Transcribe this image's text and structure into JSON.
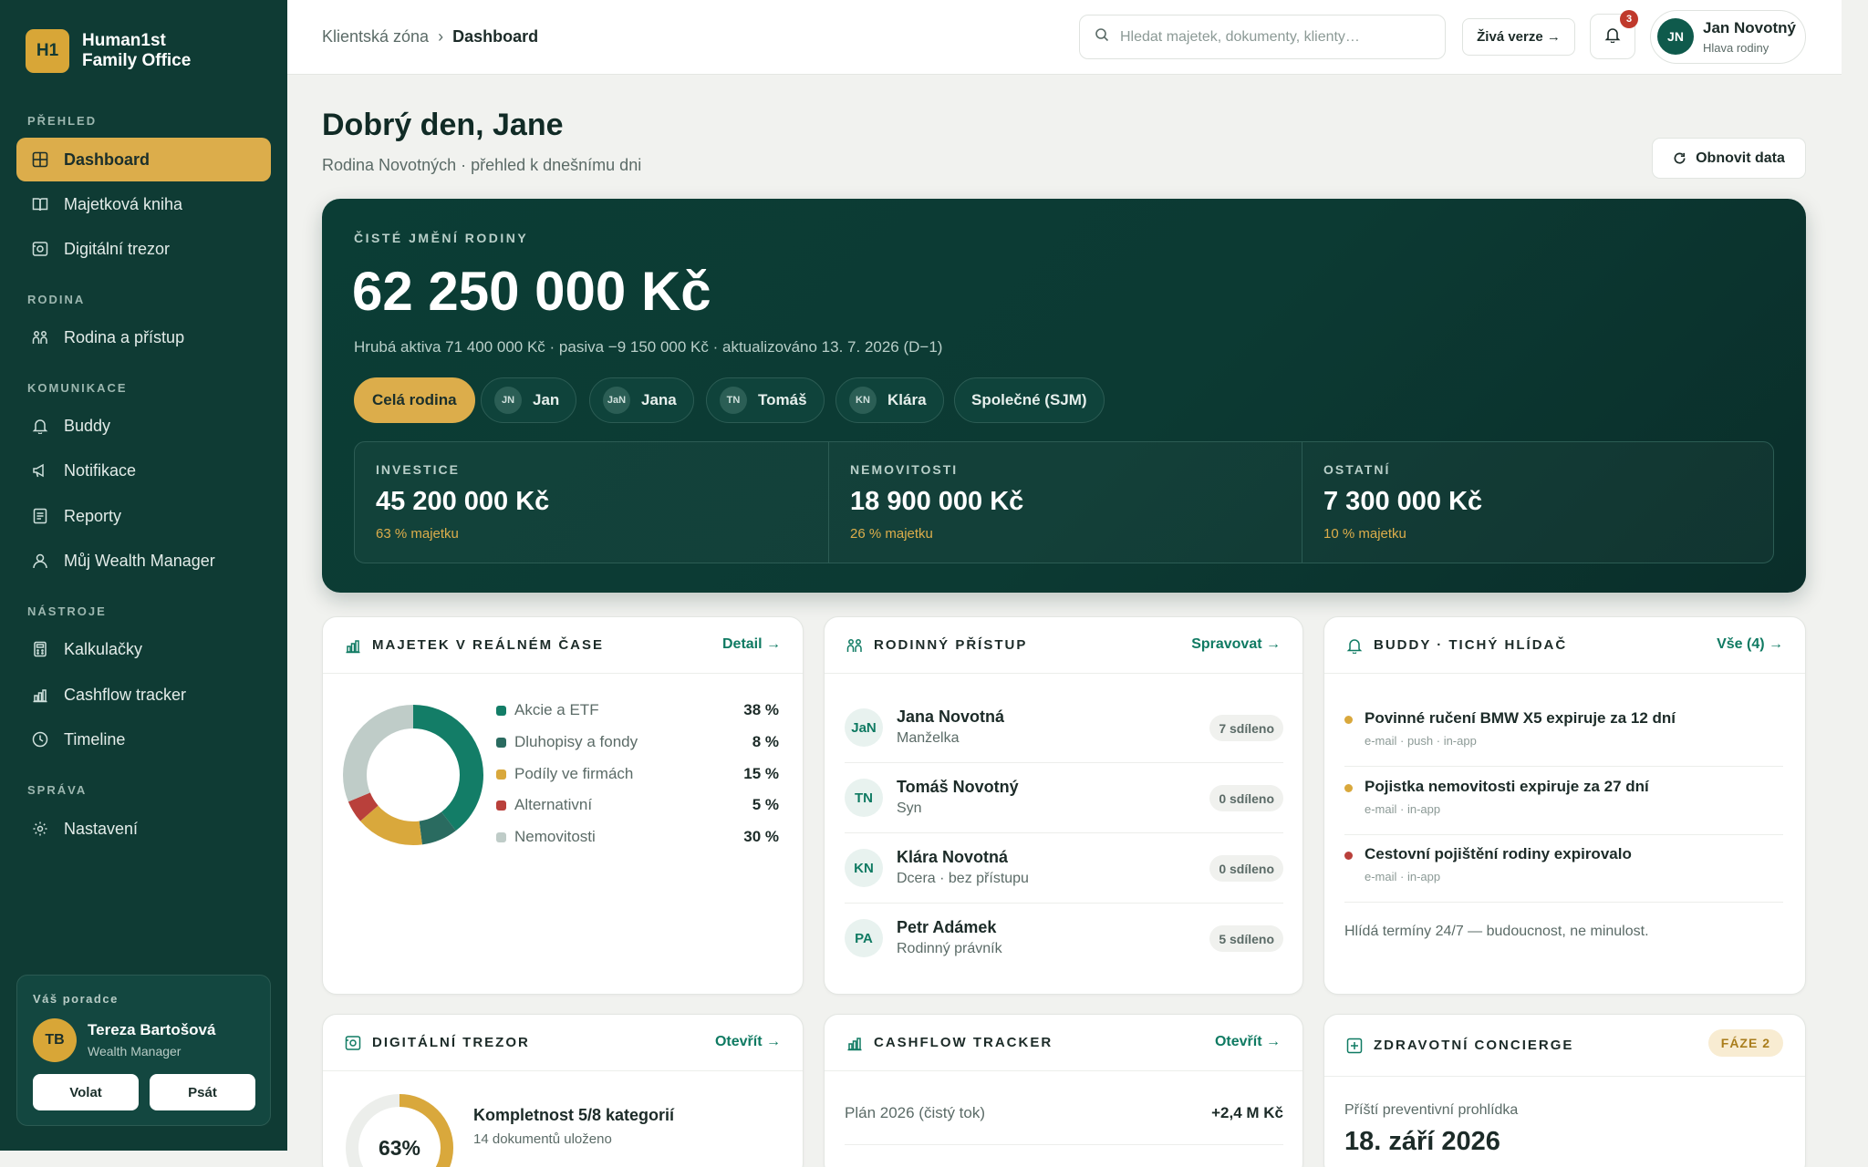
{
  "brand": {
    "logo": "H1",
    "name_line1": "Human1st",
    "name_line2": "Family Office"
  },
  "sidebar": {
    "sections": [
      {
        "label": "PŘEHLED"
      },
      {
        "label": "RODINA"
      },
      {
        "label": "KOMUNIKACE"
      },
      {
        "label": "NÁSTROJE"
      },
      {
        "label": "SPRÁVA"
      }
    ],
    "items": [
      {
        "label": "Dashboard",
        "icon": "grid-icon",
        "active": true
      },
      {
        "label": "Majetková kniha",
        "icon": "book-icon"
      },
      {
        "label": "Digitální trezor",
        "icon": "vault-icon"
      },
      {
        "label": "Rodina a přístup",
        "icon": "family-icon"
      },
      {
        "label": "Buddy",
        "icon": "bell-icon"
      },
      {
        "label": "Notifikace",
        "icon": "megaphone-icon"
      },
      {
        "label": "Reporty",
        "icon": "report-icon"
      },
      {
        "label": "Můj Wealth Manager",
        "icon": "user-icon"
      },
      {
        "label": "Kalkulačky",
        "icon": "calculator-icon"
      },
      {
        "label": "Cashflow tracker",
        "icon": "chart-icon"
      },
      {
        "label": "Timeline",
        "icon": "clock-icon"
      },
      {
        "label": "Nastavení",
        "icon": "gear-icon"
      }
    ],
    "advisor": {
      "title": "Váš poradce",
      "initials": "TB",
      "name": "Tereza Bartošová",
      "role": "Wealth Manager",
      "call_label": "Volat",
      "write_label": "Psát"
    }
  },
  "topbar": {
    "breadcrumb_root": "Klientská zóna",
    "breadcrumb_sep": "›",
    "breadcrumb_current": "Dashboard",
    "search_placeholder": "Hledat majetek, dokumenty, klienty…",
    "live_label": "Živá verze →",
    "notifications_count": "3",
    "user": {
      "initials": "JN",
      "name": "Jan Novotný",
      "role": "Hlava rodiny"
    }
  },
  "page": {
    "greeting": "Dobrý den, Jane",
    "subtitle": "Rodina Novotných · přehled k dnešnímu dni",
    "refresh_label": "Obnovit data"
  },
  "networth": {
    "label": "ČISTÉ JMĚNÍ RODINY",
    "value": "62 250 000 Kč",
    "sub": "Hrubá aktiva 71 400 000 Kč · pasiva −9 150 000 Kč · aktualizováno 13. 7. 2026 (D−1)",
    "filters": [
      {
        "label": "Celá rodina",
        "initials": "",
        "active": true
      },
      {
        "label": "Jan",
        "initials": "JN"
      },
      {
        "label": "Jana",
        "initials": "JaN"
      },
      {
        "label": "Tomáš",
        "initials": "TN"
      },
      {
        "label": "Klára",
        "initials": "KN"
      },
      {
        "label": "Společné (SJM)",
        "initials": ""
      }
    ],
    "stats": [
      {
        "label": "INVESTICE",
        "value": "45 200 000 Kč",
        "pct": "63 % majetku"
      },
      {
        "label": "NEMOVITOSTI",
        "value": "18 900 000 Kč",
        "pct": "26 % majetku"
      },
      {
        "label": "OSTATNÍ",
        "value": "7 300 000 Kč",
        "pct": "10 % majetku"
      }
    ]
  },
  "assets": {
    "title": "MAJETEK V REÁLNÉM ČASE",
    "link": "Detail →",
    "items": [
      {
        "label": "Akcie a ETF",
        "value": "38 %",
        "pct": 38,
        "color": "#137d67"
      },
      {
        "label": "Dluhopisy a fondy",
        "value": "8 %",
        "pct": 8,
        "color": "#2a6b60"
      },
      {
        "label": "Podíly ve firmách",
        "value": "15 %",
        "pct": 15,
        "color": "#d9a83c"
      },
      {
        "label": "Alternativní",
        "value": "5 %",
        "pct": 5,
        "color": "#b9403b"
      },
      {
        "label": "Nemovitosti",
        "value": "30 %",
        "pct": 30,
        "color": "#bfccc8"
      }
    ]
  },
  "family": {
    "title": "RODINNÝ PŘÍSTUP",
    "link": "Spravovat →",
    "members": [
      {
        "initials": "JaN",
        "name": "Jana Novotná",
        "role": "Manželka",
        "shared": "7 sdíleno"
      },
      {
        "initials": "TN",
        "name": "Tomáš Novotný",
        "role": "Syn",
        "shared": "0 sdíleno"
      },
      {
        "initials": "KN",
        "name": "Klára Novotná",
        "role": "Dcera · bez přístupu",
        "shared": "0 sdíleno"
      },
      {
        "initials": "PA",
        "name": "Petr Adámek",
        "role": "Rodinný právník",
        "shared": "5 sdíleno"
      }
    ]
  },
  "buddy": {
    "title": "BUDDY · TICHÝ HLÍDAČ",
    "link": "Vše (4) →",
    "alerts": [
      {
        "title": "Povinné ručení BMW X5 expiruje za 12 dní",
        "meta": "e-mail · push · in-app",
        "color": "#d9a83c"
      },
      {
        "title": "Pojistka nemovitosti expiruje za 27 dní",
        "meta": "e-mail · in-app",
        "color": "#d9a83c"
      },
      {
        "title": "Cestovní pojištění rodiny expirovalo",
        "meta": "e-mail · in-app",
        "color": "#b9403b"
      }
    ],
    "note": "Hlídá termíny 24/7 — budoucnost, ne minulost."
  },
  "vault": {
    "title": "DIGITÁLNÍ TREZOR",
    "link": "Otevřít →",
    "percent_text": "63%",
    "percent": 63,
    "completeness": "Kompletnost 5/8 kategorií",
    "docs": "14 dokumentů uloženo"
  },
  "cashflow": {
    "title": "CASHFLOW TRACKER",
    "link": "Otevřít →",
    "row_label": "Plán 2026 (čistý tok)",
    "row_value": "+2,4 M Kč"
  },
  "health": {
    "title": "ZDRAVOTNÍ CONCIERGE",
    "phase": "FÁZE 2",
    "label": "Příští preventivní prohlídka",
    "date": "18. září 2026"
  }
}
